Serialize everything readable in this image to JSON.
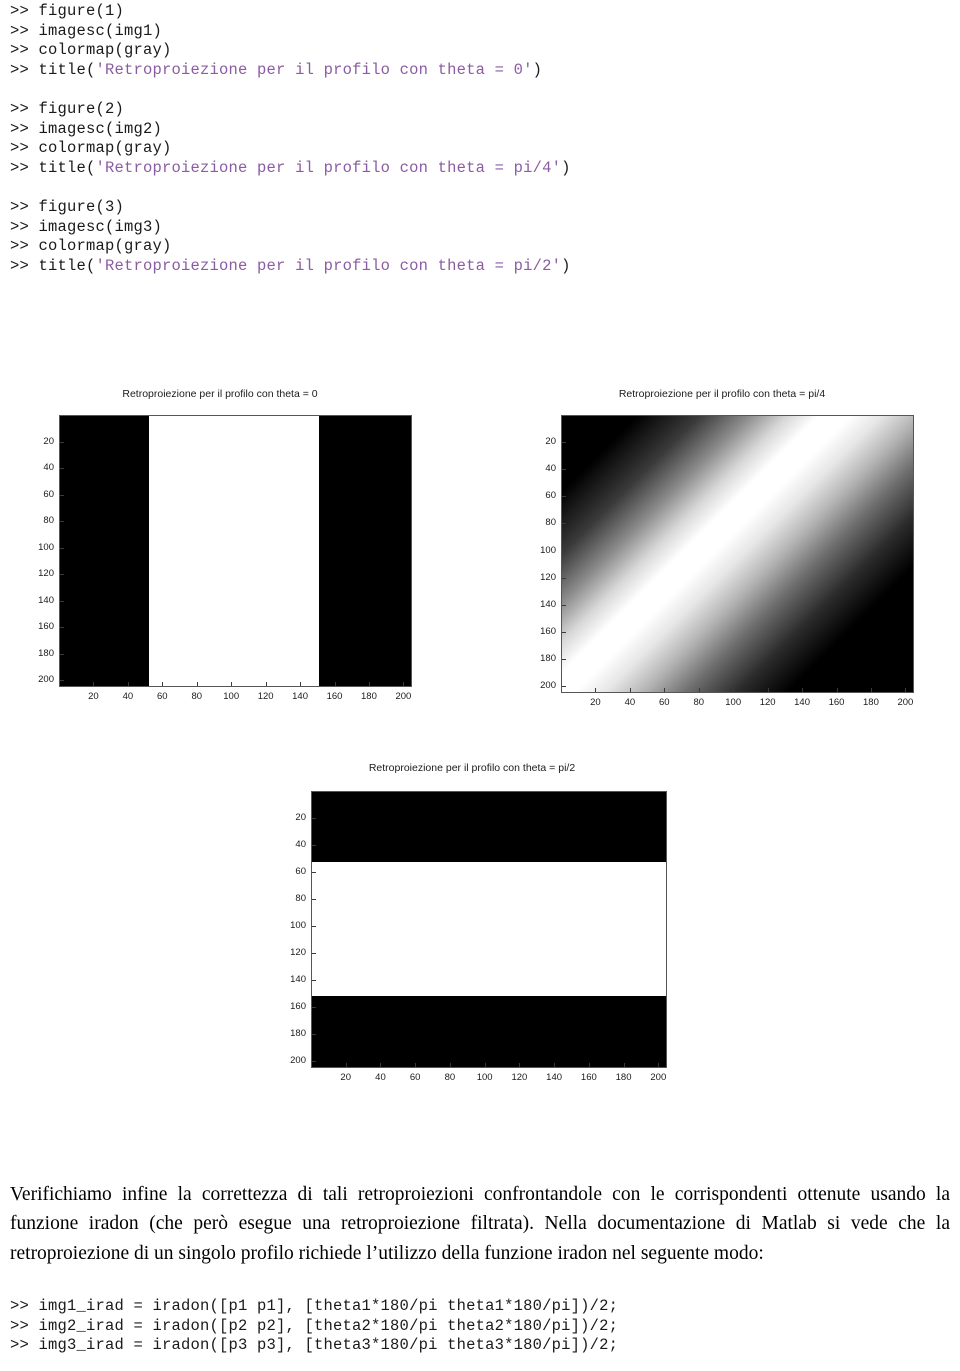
{
  "code_top": {
    "groups": [
      {
        "lines": [
          {
            "prompt": ">> ",
            "pre": "figure(1)",
            "str": "",
            "post": ""
          },
          {
            "prompt": ">> ",
            "pre": "imagesc(img1)",
            "str": "",
            "post": ""
          },
          {
            "prompt": ">> ",
            "pre": "colormap(gray)",
            "str": "",
            "post": ""
          },
          {
            "prompt": ">> ",
            "pre": "title(",
            "str": "'Retroproiezione per il profilo con theta = 0'",
            "post": ")"
          }
        ]
      },
      {
        "lines": [
          {
            "prompt": ">> ",
            "pre": "figure(2)",
            "str": "",
            "post": ""
          },
          {
            "prompt": ">> ",
            "pre": "imagesc(img2)",
            "str": "",
            "post": ""
          },
          {
            "prompt": ">> ",
            "pre": "colormap(gray)",
            "str": "",
            "post": ""
          },
          {
            "prompt": ">> ",
            "pre": "title(",
            "str": "'Retroproiezione per il profilo con theta = pi/4'",
            "post": ")"
          }
        ]
      },
      {
        "lines": [
          {
            "prompt": ">> ",
            "pre": "figure(3)",
            "str": "",
            "post": ""
          },
          {
            "prompt": ">> ",
            "pre": "imagesc(img3)",
            "str": "",
            "post": ""
          },
          {
            "prompt": ">> ",
            "pre": "colormap(gray)",
            "str": "",
            "post": ""
          },
          {
            "prompt": ">> ",
            "pre": "title(",
            "str": "'Retroproiezione per il profilo con theta = pi/2'",
            "post": ")"
          }
        ]
      }
    ]
  },
  "code_bottom": {
    "lines": [
      ">> img1_irad = iradon([p1 p1], [theta1*180/pi theta1*180/pi])/2;",
      ">> img2_irad = iradon([p2 p2], [theta2*180/pi theta2*180/pi])/2;",
      ">> img3_irad = iradon([p3 p3], [theta3*180/pi theta3*180/pi])/2;"
    ]
  },
  "paragraph": {
    "text": "Verifichiamo infine la correttezza di tali retroproiezioni confrontandole con le corrispondenti ottenute usando la funzione iradon (che però esegue una retroproiezione filtrata). Nella documentazione di Matlab si vede che la retroproiezione di un singolo profilo richiede l’utilizzo della funzione iradon nel seguente modo:"
  },
  "chart_data": [
    {
      "id": "fig1",
      "type": "heatmap",
      "title": "Retroproiezione per il profilo con theta = 0",
      "xlabel": "",
      "ylabel": "",
      "xlim": [
        0,
        205
      ],
      "ylim": [
        0,
        205
      ],
      "xticks": [
        20,
        40,
        60,
        80,
        100,
        120,
        140,
        160,
        180,
        200
      ],
      "yticks": [
        20,
        40,
        60,
        80,
        100,
        120,
        140,
        160,
        180,
        200
      ],
      "xticklabels": [
        "20",
        "40",
        "60",
        "80",
        "100",
        "120",
        "140",
        "160",
        "180",
        "200"
      ],
      "yticklabels": [
        "20",
        "40",
        "60",
        "80",
        "100",
        "120",
        "140",
        "160",
        "180",
        "200"
      ],
      "grid": false,
      "legend": "none",
      "colormap": "gray",
      "pattern": "vertical-band",
      "band_start": 52,
      "band_end": 151,
      "band_value": 1,
      "background_value": 0
    },
    {
      "id": "fig2",
      "type": "heatmap",
      "title": "Retroproiezione per il profilo con theta = pi/4",
      "xlabel": "",
      "ylabel": "",
      "xlim": [
        0,
        205
      ],
      "ylim": [
        0,
        205
      ],
      "xticks": [
        20,
        40,
        60,
        80,
        100,
        120,
        140,
        160,
        180,
        200
      ],
      "yticks": [
        20,
        40,
        60,
        80,
        100,
        120,
        140,
        160,
        180,
        200
      ],
      "xticklabels": [
        "20",
        "40",
        "60",
        "80",
        "100",
        "120",
        "140",
        "160",
        "180",
        "200"
      ],
      "yticklabels": [
        "20",
        "40",
        "60",
        "80",
        "100",
        "120",
        "140",
        "160",
        "180",
        "200"
      ],
      "grid": false,
      "legend": "none",
      "colormap": "gray",
      "pattern": "diagonal-gradient-band",
      "band_direction": "top-left-to-bottom-right",
      "band_peak_value": 1,
      "background_value": 0
    },
    {
      "id": "fig3",
      "type": "heatmap",
      "title": "Retroproiezione per il profilo con theta = pi/2",
      "xlabel": "",
      "ylabel": "",
      "xlim": [
        0,
        205
      ],
      "ylim": [
        0,
        205
      ],
      "xticks": [
        20,
        40,
        60,
        80,
        100,
        120,
        140,
        160,
        180,
        200
      ],
      "yticks": [
        20,
        40,
        60,
        80,
        100,
        120,
        140,
        160,
        180,
        200
      ],
      "xticklabels": [
        "20",
        "40",
        "60",
        "80",
        "100",
        "120",
        "140",
        "160",
        "180",
        "200"
      ],
      "yticklabels": [
        "20",
        "40",
        "60",
        "80",
        "100",
        "120",
        "140",
        "160",
        "180",
        "200"
      ],
      "grid": false,
      "legend": "none",
      "colormap": "gray",
      "pattern": "horizontal-band",
      "band_start": 52,
      "band_end": 152,
      "band_value": 1,
      "background_value": 0
    }
  ]
}
